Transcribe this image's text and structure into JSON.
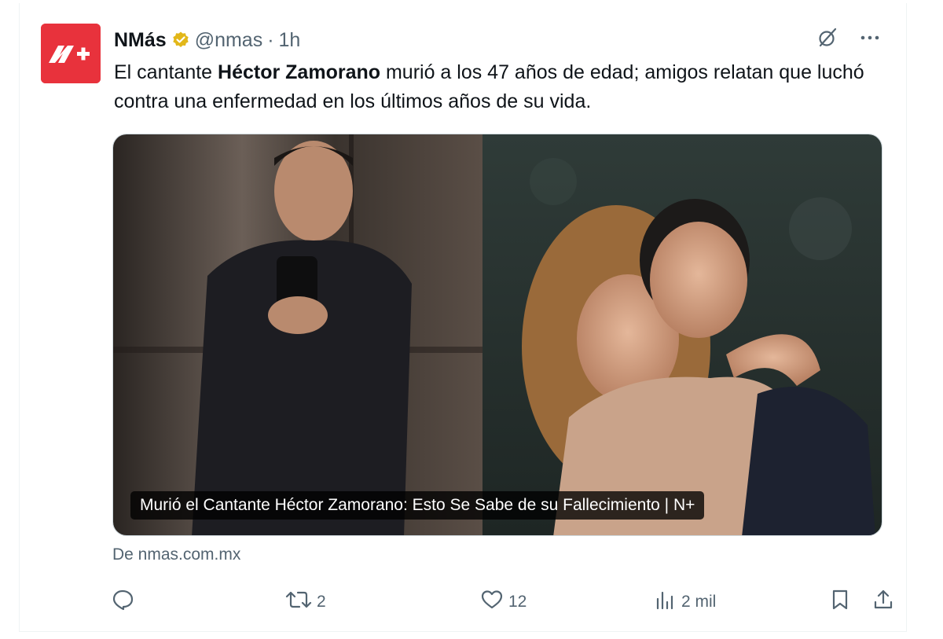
{
  "tweet": {
    "author_name": "NMás",
    "handle": "@nmas",
    "separator": "·",
    "time": "1h",
    "text_before": "El cantante ",
    "text_bold": "Héctor Zamorano",
    "text_after": " murió a los 47 años de edad; amigos relatan que luchó contra una enfermedad en los últimos años de su vida.",
    "card_caption": "Murió el Cantante Héctor Zamorano: Esto Se Sabe de su Fallecimiento | N+",
    "source": "De nmas.com.mx",
    "retweets": "2",
    "likes": "12",
    "views": "2 mil"
  },
  "icons": {
    "grok": "grok-icon",
    "more": "more-icon",
    "reply": "reply-icon",
    "retweet": "retweet-icon",
    "like": "heart-icon",
    "views": "views-icon",
    "bookmark": "bookmark-icon",
    "share": "share-icon",
    "verified": "verified-badge-icon"
  },
  "colors": {
    "avatar_bg": "#e8323c",
    "verified_gold": "#e2b719",
    "muted": "#536471",
    "text": "#0f1419"
  }
}
